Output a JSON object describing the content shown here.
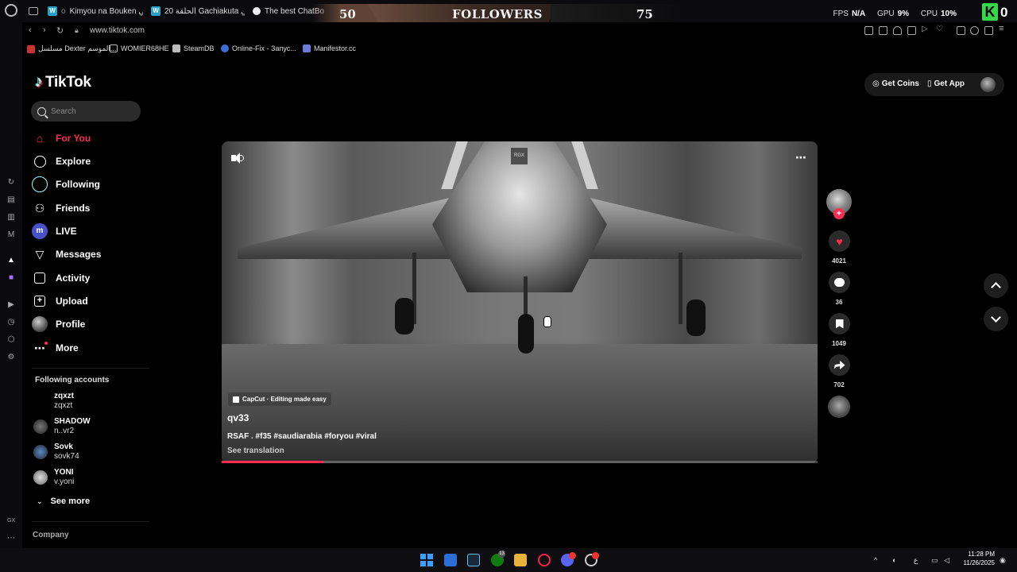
{
  "browser": {
    "tabs": [
      {
        "label": "Kimyou na Bouken انمي",
        "prefix": "o"
      },
      {
        "label": "20 الحلقة Gachiakuta انمي"
      },
      {
        "label": "The best ChatBot"
      }
    ],
    "url": "www.tiktok.com",
    "bookmarks": [
      {
        "label": "مسلسل Dexter الموسم..."
      },
      {
        "label": "WOMIER68HE"
      },
      {
        "label": "SteamDB"
      },
      {
        "label": "Online-Fix - Запус..."
      },
      {
        "label": "Manifestor.cc"
      }
    ],
    "gx_label": "GX"
  },
  "overlay": {
    "followers_count": "50",
    "followers_label": "FOLLOWERS",
    "followers_goal": "75"
  },
  "hwstats": {
    "fps_label": "FPS",
    "fps_value": "N/A",
    "gpu_label": "GPU",
    "gpu_value": "9%",
    "cpu_label": "CPU",
    "cpu_value": "10%",
    "k_badge": "K",
    "k_zero": "0"
  },
  "tiktok": {
    "logo": "TikTok",
    "search_placeholder": "Search",
    "nav": [
      {
        "label": "For You",
        "icon": "home-icon"
      },
      {
        "label": "Explore",
        "icon": "compass-icon"
      },
      {
        "label": "Following",
        "icon": "following-icon"
      },
      {
        "label": "Friends",
        "icon": "friends-icon"
      },
      {
        "label": "LIVE",
        "icon": "live-icon"
      },
      {
        "label": "Messages",
        "icon": "messages-icon"
      },
      {
        "label": "Activity",
        "icon": "activity-icon"
      },
      {
        "label": "Upload",
        "icon": "upload-icon"
      },
      {
        "label": "Profile",
        "icon": "profile-icon"
      },
      {
        "label": "More",
        "icon": "more-icon"
      }
    ],
    "following_header": "Following accounts",
    "accounts": [
      {
        "name": "zqxzt",
        "handle": "zqxzt"
      },
      {
        "name": "SHADOW",
        "handle": "n..vr2"
      },
      {
        "name": "Sovk",
        "handle": "sovk74"
      },
      {
        "name": "YONI",
        "handle": "v.yoni"
      }
    ],
    "see_more": "See more",
    "company": "Company",
    "get_coins": "Get Coins",
    "get_app": "Get App"
  },
  "video": {
    "watermark": "RGX",
    "capcut_label": "CapCut · Editing made easy",
    "author": "qv33",
    "caption": "RSAF . #f35 #saudiarabia #foryou #viral",
    "translate": "See translation",
    "progress": 0.17,
    "likes": "4021",
    "comments": "36",
    "saves": "1049",
    "shares": "702"
  },
  "taskbar": {
    "time": "11:28 PM",
    "date": "11/26/2025",
    "lang": "ع",
    "badge_count": "13"
  },
  "colors": {
    "accent": "#fe2c55",
    "gx_green": "#35d84a"
  }
}
